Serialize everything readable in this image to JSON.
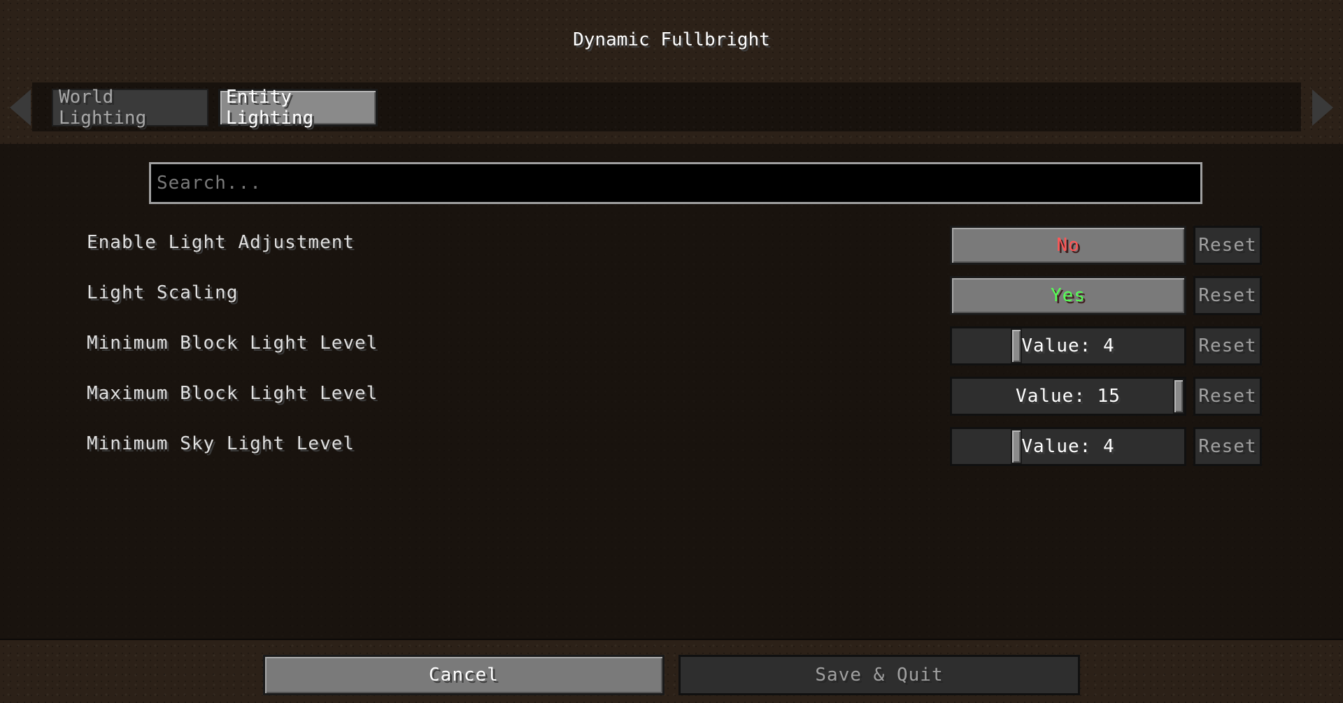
{
  "window": {
    "title": "Dynamic Fullbright"
  },
  "tabs": [
    {
      "label": "World Lighting",
      "selected": false
    },
    {
      "label": "Entity Lighting",
      "selected": true
    }
  ],
  "search": {
    "placeholder": "Search..."
  },
  "options": [
    {
      "label": "Enable Light Adjustment",
      "type": "toggle",
      "value_text": "No",
      "value_color": "#ff5555",
      "reset_label": "Reset"
    },
    {
      "label": "Light Scaling",
      "type": "toggle",
      "value_text": "Yes",
      "value_color": "#55ff55",
      "reset_label": "Reset"
    },
    {
      "label": "Minimum Block Light Level",
      "type": "slider",
      "value_text": "Value: 4",
      "level": 4,
      "max": 15,
      "reset_label": "Reset"
    },
    {
      "label": "Maximum Block Light Level",
      "type": "slider",
      "value_text": "Value: 15",
      "level": 15,
      "max": 15,
      "reset_label": "Reset"
    },
    {
      "label": "Minimum Sky Light Level",
      "type": "slider",
      "value_text": "Value: 4",
      "level": 4,
      "max": 15,
      "reset_label": "Reset"
    }
  ],
  "footer": {
    "cancel_label": "Cancel",
    "save_quit_label": "Save & Quit"
  },
  "icons": {
    "scroll_left": "arrow-left-icon",
    "scroll_right": "arrow-right-icon"
  }
}
